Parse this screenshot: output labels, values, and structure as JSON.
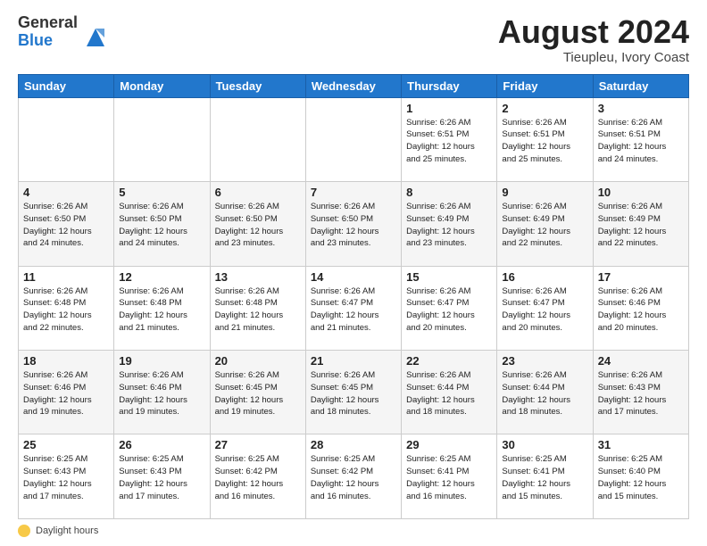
{
  "header": {
    "logo_general": "General",
    "logo_blue": "Blue",
    "month_year": "August 2024",
    "location": "Tieupleu, Ivory Coast"
  },
  "days_of_week": [
    "Sunday",
    "Monday",
    "Tuesday",
    "Wednesday",
    "Thursday",
    "Friday",
    "Saturday"
  ],
  "weeks": [
    [
      {
        "num": "",
        "info": ""
      },
      {
        "num": "",
        "info": ""
      },
      {
        "num": "",
        "info": ""
      },
      {
        "num": "",
        "info": ""
      },
      {
        "num": "1",
        "info": "Sunrise: 6:26 AM\nSunset: 6:51 PM\nDaylight: 12 hours\nand 25 minutes."
      },
      {
        "num": "2",
        "info": "Sunrise: 6:26 AM\nSunset: 6:51 PM\nDaylight: 12 hours\nand 25 minutes."
      },
      {
        "num": "3",
        "info": "Sunrise: 6:26 AM\nSunset: 6:51 PM\nDaylight: 12 hours\nand 24 minutes."
      }
    ],
    [
      {
        "num": "4",
        "info": "Sunrise: 6:26 AM\nSunset: 6:50 PM\nDaylight: 12 hours\nand 24 minutes."
      },
      {
        "num": "5",
        "info": "Sunrise: 6:26 AM\nSunset: 6:50 PM\nDaylight: 12 hours\nand 24 minutes."
      },
      {
        "num": "6",
        "info": "Sunrise: 6:26 AM\nSunset: 6:50 PM\nDaylight: 12 hours\nand 23 minutes."
      },
      {
        "num": "7",
        "info": "Sunrise: 6:26 AM\nSunset: 6:50 PM\nDaylight: 12 hours\nand 23 minutes."
      },
      {
        "num": "8",
        "info": "Sunrise: 6:26 AM\nSunset: 6:49 PM\nDaylight: 12 hours\nand 23 minutes."
      },
      {
        "num": "9",
        "info": "Sunrise: 6:26 AM\nSunset: 6:49 PM\nDaylight: 12 hours\nand 22 minutes."
      },
      {
        "num": "10",
        "info": "Sunrise: 6:26 AM\nSunset: 6:49 PM\nDaylight: 12 hours\nand 22 minutes."
      }
    ],
    [
      {
        "num": "11",
        "info": "Sunrise: 6:26 AM\nSunset: 6:48 PM\nDaylight: 12 hours\nand 22 minutes."
      },
      {
        "num": "12",
        "info": "Sunrise: 6:26 AM\nSunset: 6:48 PM\nDaylight: 12 hours\nand 21 minutes."
      },
      {
        "num": "13",
        "info": "Sunrise: 6:26 AM\nSunset: 6:48 PM\nDaylight: 12 hours\nand 21 minutes."
      },
      {
        "num": "14",
        "info": "Sunrise: 6:26 AM\nSunset: 6:47 PM\nDaylight: 12 hours\nand 21 minutes."
      },
      {
        "num": "15",
        "info": "Sunrise: 6:26 AM\nSunset: 6:47 PM\nDaylight: 12 hours\nand 20 minutes."
      },
      {
        "num": "16",
        "info": "Sunrise: 6:26 AM\nSunset: 6:47 PM\nDaylight: 12 hours\nand 20 minutes."
      },
      {
        "num": "17",
        "info": "Sunrise: 6:26 AM\nSunset: 6:46 PM\nDaylight: 12 hours\nand 20 minutes."
      }
    ],
    [
      {
        "num": "18",
        "info": "Sunrise: 6:26 AM\nSunset: 6:46 PM\nDaylight: 12 hours\nand 19 minutes."
      },
      {
        "num": "19",
        "info": "Sunrise: 6:26 AM\nSunset: 6:46 PM\nDaylight: 12 hours\nand 19 minutes."
      },
      {
        "num": "20",
        "info": "Sunrise: 6:26 AM\nSunset: 6:45 PM\nDaylight: 12 hours\nand 19 minutes."
      },
      {
        "num": "21",
        "info": "Sunrise: 6:26 AM\nSunset: 6:45 PM\nDaylight: 12 hours\nand 18 minutes."
      },
      {
        "num": "22",
        "info": "Sunrise: 6:26 AM\nSunset: 6:44 PM\nDaylight: 12 hours\nand 18 minutes."
      },
      {
        "num": "23",
        "info": "Sunrise: 6:26 AM\nSunset: 6:44 PM\nDaylight: 12 hours\nand 18 minutes."
      },
      {
        "num": "24",
        "info": "Sunrise: 6:26 AM\nSunset: 6:43 PM\nDaylight: 12 hours\nand 17 minutes."
      }
    ],
    [
      {
        "num": "25",
        "info": "Sunrise: 6:25 AM\nSunset: 6:43 PM\nDaylight: 12 hours\nand 17 minutes."
      },
      {
        "num": "26",
        "info": "Sunrise: 6:25 AM\nSunset: 6:43 PM\nDaylight: 12 hours\nand 17 minutes."
      },
      {
        "num": "27",
        "info": "Sunrise: 6:25 AM\nSunset: 6:42 PM\nDaylight: 12 hours\nand 16 minutes."
      },
      {
        "num": "28",
        "info": "Sunrise: 6:25 AM\nSunset: 6:42 PM\nDaylight: 12 hours\nand 16 minutes."
      },
      {
        "num": "29",
        "info": "Sunrise: 6:25 AM\nSunset: 6:41 PM\nDaylight: 12 hours\nand 16 minutes."
      },
      {
        "num": "30",
        "info": "Sunrise: 6:25 AM\nSunset: 6:41 PM\nDaylight: 12 hours\nand 15 minutes."
      },
      {
        "num": "31",
        "info": "Sunrise: 6:25 AM\nSunset: 6:40 PM\nDaylight: 12 hours\nand 15 minutes."
      }
    ]
  ],
  "footer": {
    "daylight_label": "Daylight hours"
  }
}
